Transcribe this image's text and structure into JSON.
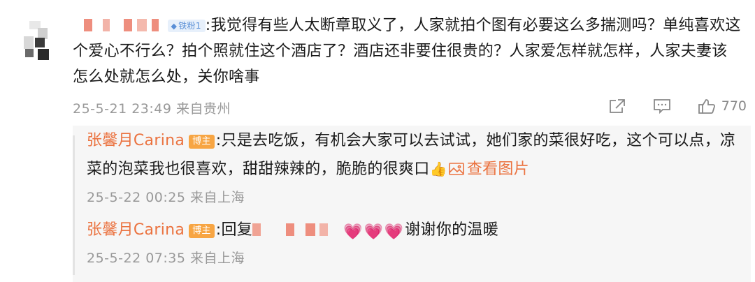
{
  "main_comment": {
    "fan_badge_icon": "diamond-icon",
    "fan_badge_label": "铁粉1",
    "lines": [
      ":我觉得有些人太断章取义了，人家就拍个图有必要这么多揣测吗？单纯喜欢这",
      "个爱心不行么？拍个照就住这个酒店了？酒店还非要住很贵的？人家爱怎样就怎样，人家夫妻该",
      "怎么处就怎么处，关你啥事"
    ],
    "meta": "25-5-21 23:49 来自贵州",
    "like_count": "770",
    "icons": [
      "share-icon",
      "comment-icon",
      "like-icon"
    ]
  },
  "replies": [
    {
      "user": "张馨月Carina",
      "badge": "博主",
      "text_line1": ":只是去吃饭，有机会大家可以去试试，她们家的菜很好吃，这个可以点，凉",
      "text_line2": "菜的泡菜我也很喜欢，甜甜辣辣的，脆脆的很爽口",
      "thumb_emoji": "👍",
      "view_image": "查看图片",
      "meta": "25-5-22 00:25 来自上海"
    },
    {
      "user": "张馨月Carina",
      "badge": "博主",
      "reply_prefix": ":回复",
      "hearts": "💗💗💗",
      "text": "谢谢你的温暖",
      "meta": "25-5-22 07:35 来自上海"
    }
  ],
  "colors": {
    "accent_orange": "#eb7340",
    "meta_gray": "#999999",
    "badge_orange": "#f7a543",
    "fan_badge_blue": "#5a8fd6",
    "reply_bg": "#f6f6f6"
  }
}
